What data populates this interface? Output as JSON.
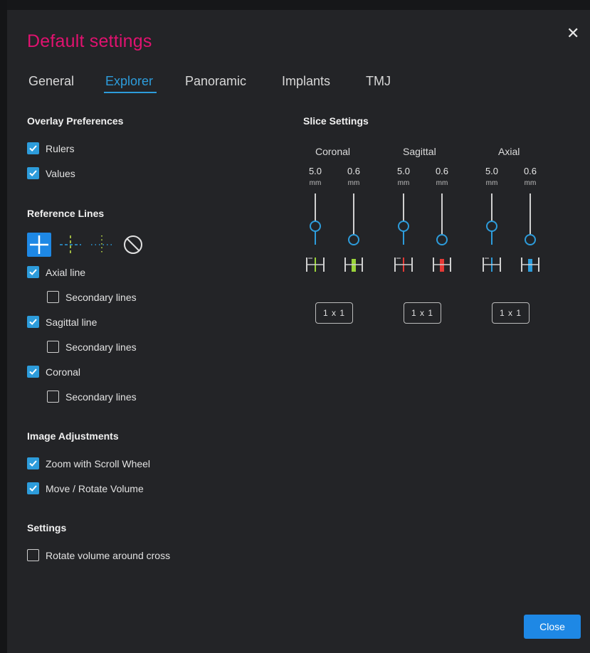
{
  "dialog": {
    "title": "Default settings"
  },
  "tabs": [
    {
      "label": "General"
    },
    {
      "label": "Explorer"
    },
    {
      "label": "Panoramic"
    },
    {
      "label": "Implants"
    },
    {
      "label": "TMJ"
    }
  ],
  "active_tab": "Explorer",
  "overlay": {
    "heading": "Overlay Preferences",
    "rulers": {
      "label": "Rulers",
      "checked": true
    },
    "values": {
      "label": "Values",
      "checked": true
    }
  },
  "reference": {
    "heading": "Reference Lines",
    "styles": [
      "solid-cross-icon",
      "dashed-cross-icon",
      "dotted-cross-icon",
      "none-icon"
    ],
    "axial": {
      "label": "Axial line",
      "checked": true
    },
    "axial_secondary": {
      "label": "Secondary lines",
      "checked": false
    },
    "sagittal": {
      "label": "Sagittal line",
      "checked": true
    },
    "sagittal_secondary": {
      "label": "Secondary lines",
      "checked": false
    },
    "coronal": {
      "label": "Coronal",
      "checked": true
    },
    "coronal_secondary": {
      "label": "Secondary lines",
      "checked": false
    }
  },
  "image_adj": {
    "heading": "Image Adjustments",
    "zoom": {
      "label": "Zoom with Scroll Wheel",
      "checked": true
    },
    "move": {
      "label": "Move / Rotate Volume",
      "checked": true
    }
  },
  "settings": {
    "heading": "Settings",
    "rotate": {
      "label": "Rotate volume around cross",
      "checked": false
    }
  },
  "slice": {
    "heading": "Slice Settings",
    "unit": "mm",
    "columns": [
      {
        "name": "Coronal",
        "thickness": "5.0",
        "spacing": "0.6",
        "layout": "1 x 1",
        "color": "#9bd43a"
      },
      {
        "name": "Sagittal",
        "thickness": "5.0",
        "spacing": "0.6",
        "layout": "1 x 1",
        "color": "#e53935"
      },
      {
        "name": "Axial",
        "thickness": "5.0",
        "spacing": "0.6",
        "layout": "1 x 1",
        "color": "#2d9cdb"
      }
    ]
  },
  "footer": {
    "close_label": "Close"
  },
  "colors": {
    "accent": "#2d9cdb",
    "title": "#e0126f",
    "button": "#1e88e5"
  }
}
